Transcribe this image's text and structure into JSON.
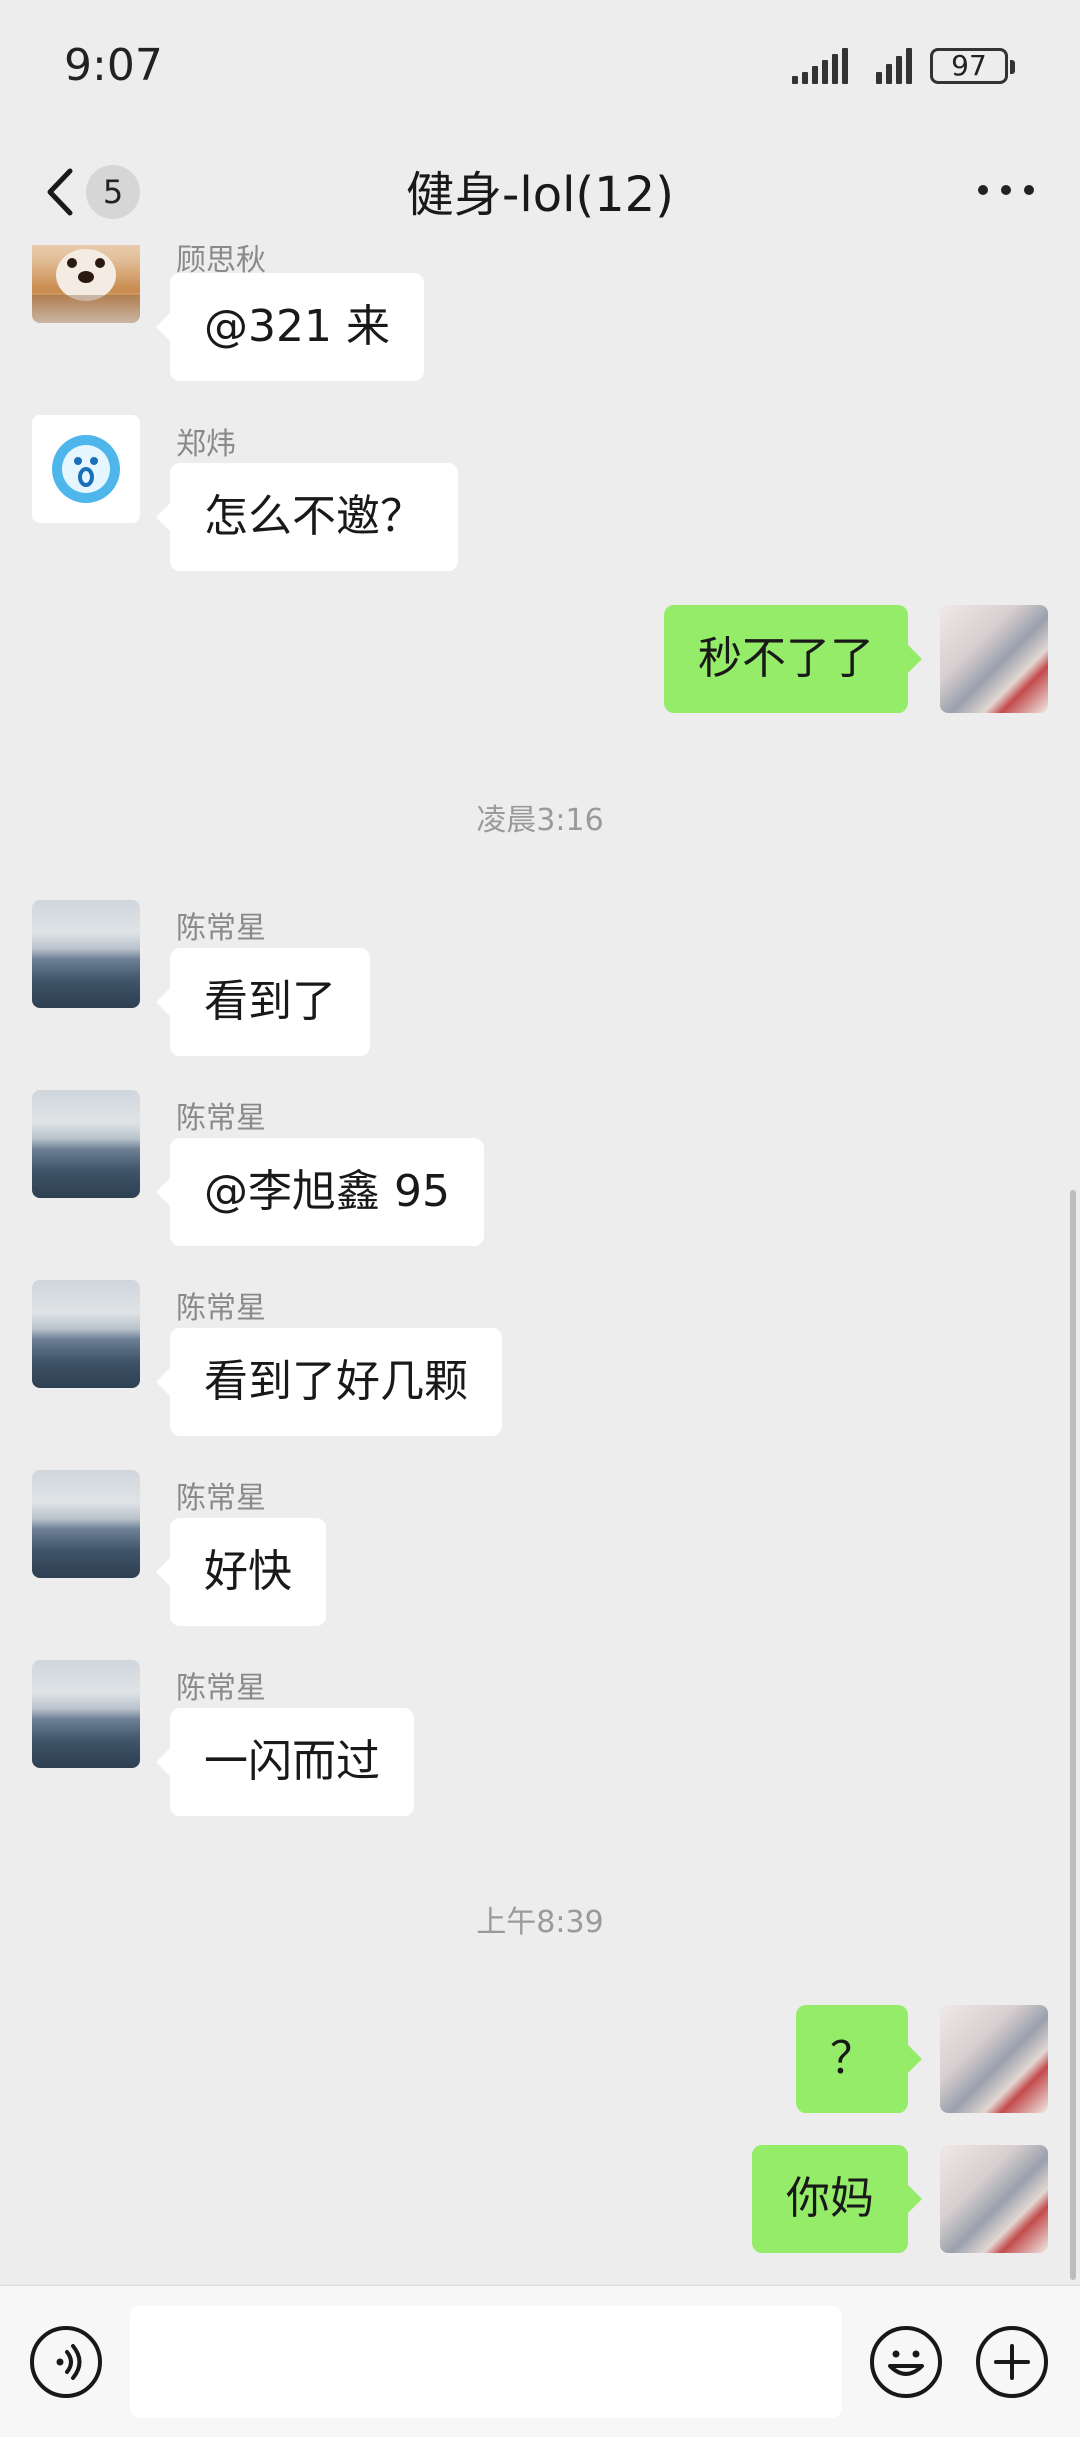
{
  "status_bar": {
    "time": "9:07",
    "battery": "97"
  },
  "nav": {
    "back_badge": "5",
    "title": "健身-lol(12)"
  },
  "messages": [
    {
      "sender": "顾思秋",
      "text": "@321 来"
    },
    {
      "sender": "郑炜",
      "text": "怎么不邀？"
    },
    {
      "text": "秒不了了"
    },
    {
      "time": "凌晨3:16"
    },
    {
      "sender": "陈常星",
      "text": "看到了"
    },
    {
      "sender": "陈常星",
      "text": "@李旭鑫 95"
    },
    {
      "sender": "陈常星",
      "text": "看到了好几颗"
    },
    {
      "sender": "陈常星",
      "text": "好快"
    },
    {
      "sender": "陈常星",
      "text": "一闪而过"
    },
    {
      "time": "上午8:39"
    },
    {
      "text": "？"
    },
    {
      "text": "你妈"
    }
  ],
  "input": {
    "placeholder": ""
  },
  "colors": {
    "background": "#ededed",
    "outgoing_bubble": "#95ec69",
    "incoming_bubble": "#ffffff"
  },
  "icons": [
    "chevron-left-icon",
    "more-icon",
    "voice-icon",
    "emoji-icon",
    "plus-icon"
  ]
}
